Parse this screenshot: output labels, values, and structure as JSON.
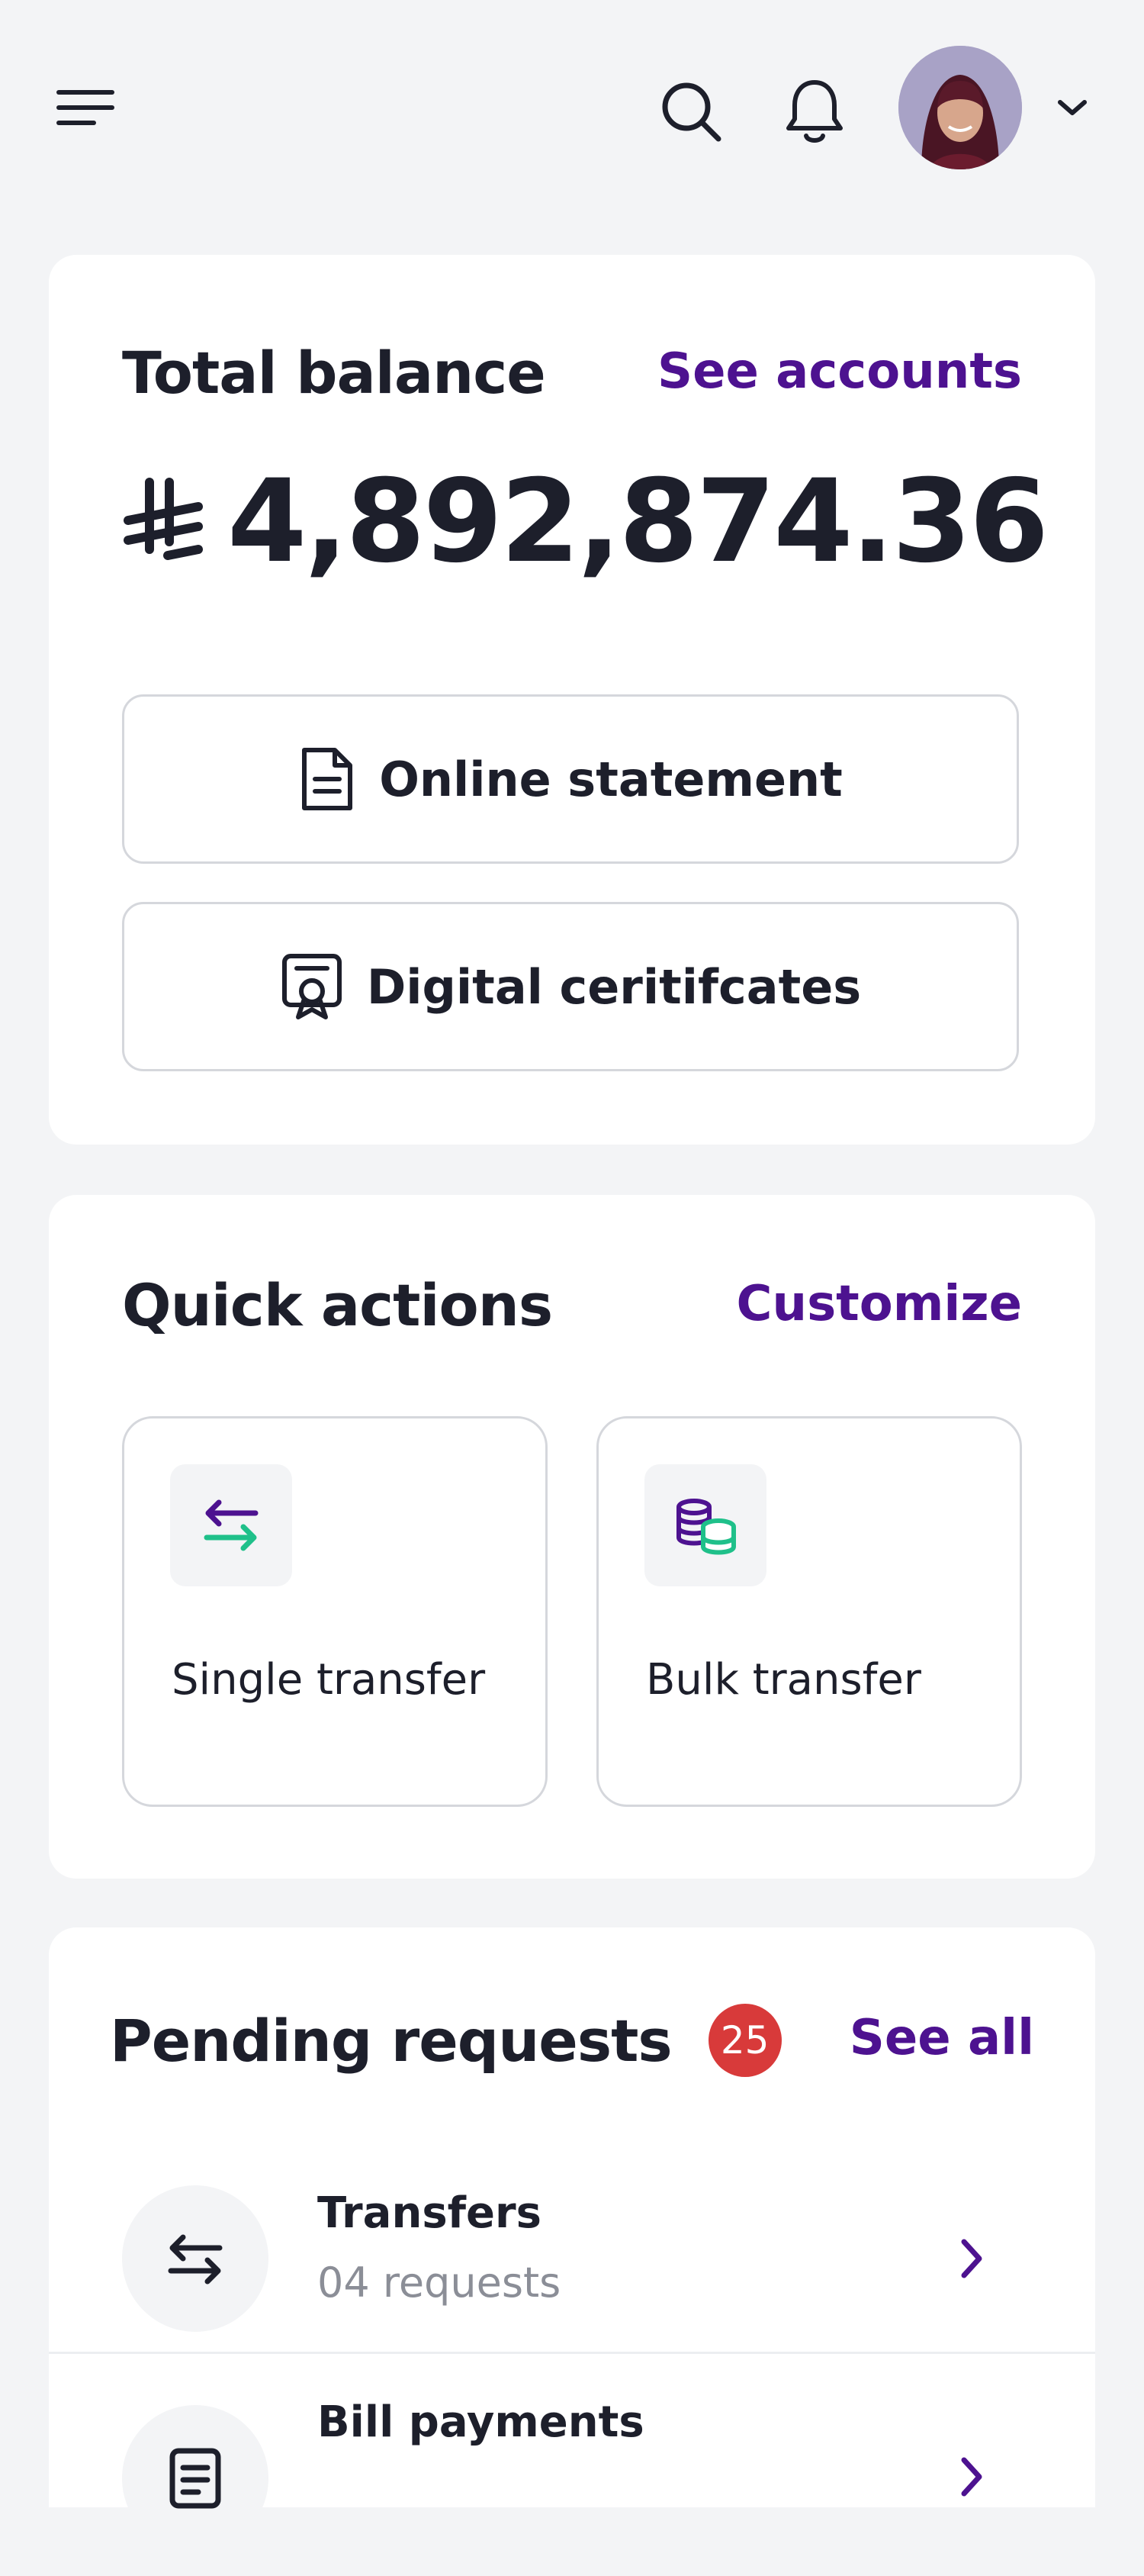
{
  "header": {
    "menu_icon": "hamburger-icon",
    "search_icon": "search-icon",
    "bell_icon": "bell-icon",
    "avatar_alt": "User avatar",
    "dropdown_icon": "chevron-down-icon"
  },
  "balance": {
    "title": "Total balance",
    "see_accounts": "See accounts",
    "currency_symbol": "⃁",
    "amount": "4,892,874.36",
    "online_statement": "Online statement",
    "digital_certificates": "Digital ceritifcates"
  },
  "quick_actions": {
    "title": "Quick actions",
    "customize": "Customize",
    "tiles": [
      {
        "label": "Single transfer",
        "icon": "transfer-arrows-icon"
      },
      {
        "label": "Bulk transfer",
        "icon": "coins-stack-icon"
      }
    ]
  },
  "pending": {
    "title": "Pending requests",
    "count": "25",
    "see_all": "See all",
    "items": [
      {
        "title": "Transfers",
        "subtitle": "04 requests",
        "icon": "transfer-arrows-icon"
      },
      {
        "title": "Bill payments",
        "subtitle": "",
        "icon": "receipt-icon"
      }
    ]
  },
  "colors": {
    "accent_purple": "#4d1290",
    "accent_green": "#1fc08a",
    "badge_red": "#d83a3a",
    "background": "#f3f4f6"
  }
}
